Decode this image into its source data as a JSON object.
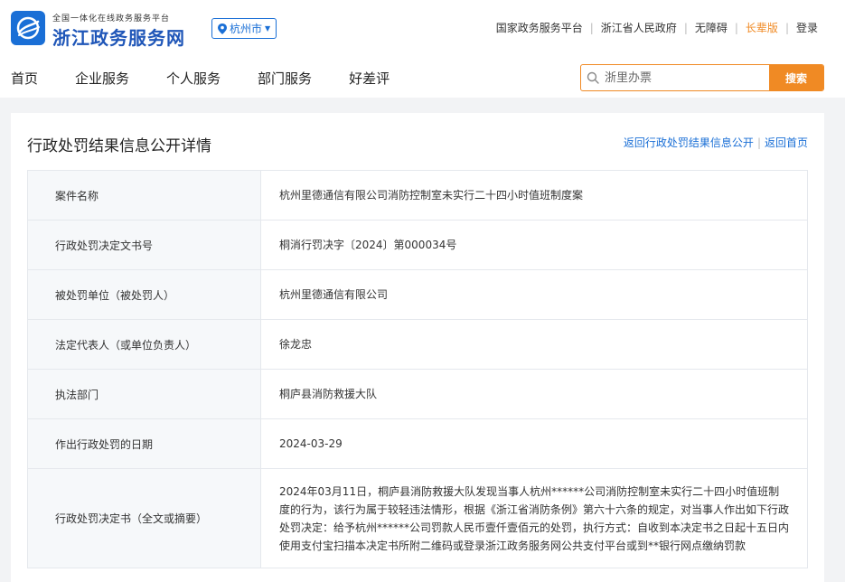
{
  "header": {
    "brand_sub": "全国一体化在线政务服务平台",
    "brand_title": "浙江政务服务网",
    "city": "杭州市",
    "links": [
      "国家政务服务平台",
      "浙江省人民政府",
      "无障碍",
      "长辈版",
      "登录"
    ]
  },
  "nav": {
    "items": [
      "首页",
      "企业服务",
      "个人服务",
      "部门服务",
      "好差评"
    ]
  },
  "search": {
    "placeholder": "浙里办票",
    "button": "搜索"
  },
  "colors": {
    "brand_blue": "#1a6fd6",
    "accent_orange": "#f08a24"
  },
  "page": {
    "title": "行政处罚结果信息公开详情",
    "back_link": "返回行政处罚结果信息公开",
    "home_link": "返回首页"
  },
  "rows": [
    {
      "label": "案件名称",
      "value": "杭州里德通信有限公司消防控制室未实行二十四小时值班制度案"
    },
    {
      "label": "行政处罚决定文书号",
      "value": "桐消行罚决字〔2024〕第000034号"
    },
    {
      "label": "被处罚单位（被处罚人）",
      "value": "杭州里德通信有限公司"
    },
    {
      "label": "法定代表人（或单位负责人）",
      "value": "徐龙忠"
    },
    {
      "label": "执法部门",
      "value": "桐庐县消防救援大队"
    },
    {
      "label": "作出行政处罚的日期",
      "value": "2024-03-29"
    },
    {
      "label": "行政处罚决定书（全文或摘要）",
      "value": "2024年03月11日，桐庐县消防救援大队发现当事人杭州******公司消防控制室未实行二十四小时值班制度的行为，该行为属于较轻违法情形，根据《浙江省消防条例》第六十六条的规定，对当事人作出如下行政处罚决定：给予杭州******公司罚款人民币壹仟壹佰元的处罚，执行方式：自收到本决定书之日起十五日内使用支付宝扫描本决定书所附二维码或登录浙江政务服务网公共支付平台或到**银行网点缴纳罚款"
    }
  ]
}
